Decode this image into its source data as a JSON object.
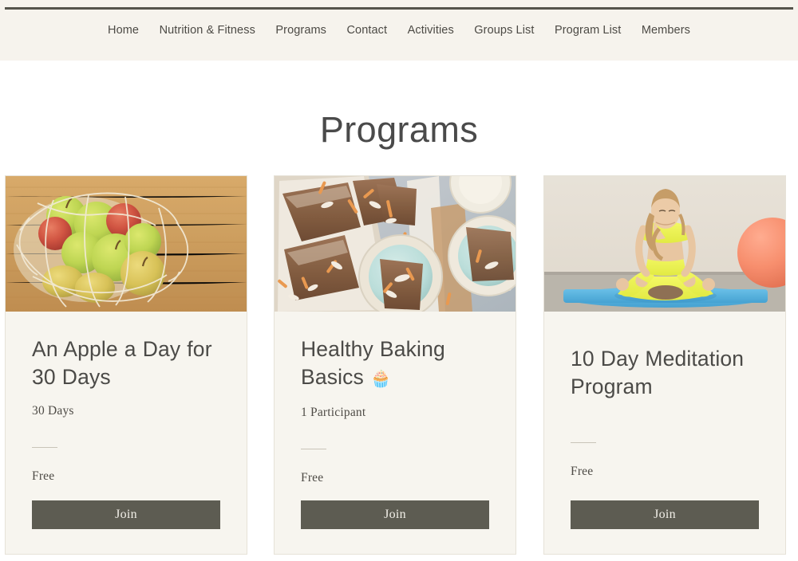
{
  "header": {
    "nav_items": [
      {
        "label": "Home"
      },
      {
        "label": "Nutrition & Fitness"
      },
      {
        "label": "Programs"
      },
      {
        "label": "Contact"
      },
      {
        "label": "Activities"
      },
      {
        "label": "Groups List"
      },
      {
        "label": "Program List"
      },
      {
        "label": "Members"
      }
    ],
    "background_color": "#f6f3ed",
    "rule_color": "#55544c"
  },
  "main": {
    "page_title": "Programs",
    "cards": [
      {
        "title": "An Apple a Day for 30 Days",
        "emoji": "",
        "meta": "30 Days",
        "price": "Free",
        "join_label": "Join",
        "image_alt": "apples-in-mesh-bag-on-wooden-table"
      },
      {
        "title": "Healthy Baking Basics",
        "emoji": "🧁",
        "meta": "1 Participant",
        "price": "Free",
        "join_label": "Join",
        "image_alt": "carrot-cake-slices-on-plates"
      },
      {
        "title": "10 Day Meditation Program",
        "emoji": "",
        "meta": "",
        "price": "Free",
        "join_label": "Join",
        "image_alt": "woman-meditating-in-lotus-pose-on-blue-mat"
      }
    ]
  },
  "theme": {
    "page_background": "#ffffff",
    "card_background": "#f7f5ef",
    "card_border": "#e6e2d8",
    "button_background": "#5d5c52",
    "button_text": "#f2efe8",
    "text_color": "#4b4a47"
  }
}
